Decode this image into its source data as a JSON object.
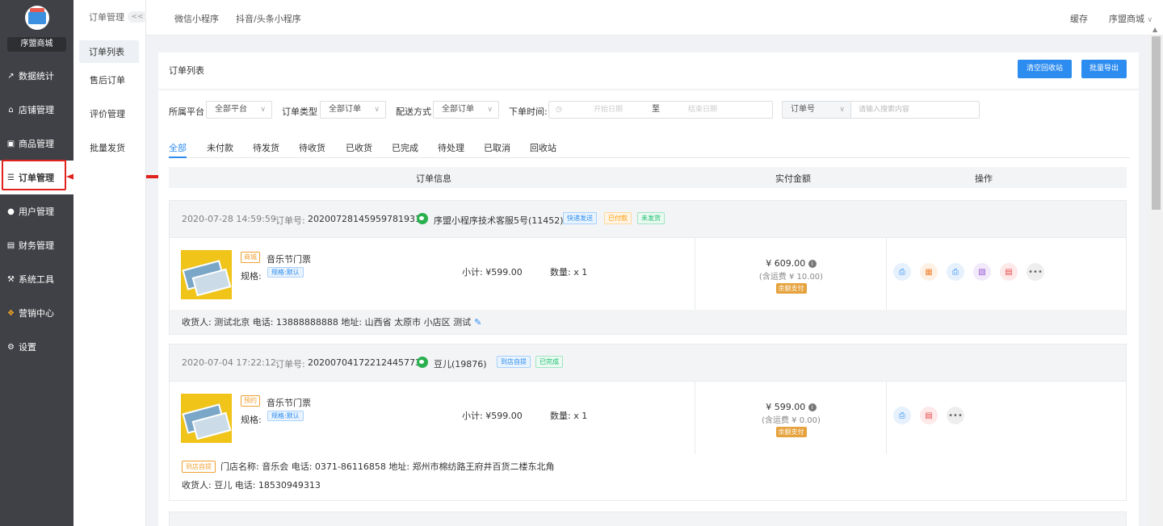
{
  "sidebar": {
    "shop_name": "序盟商城",
    "items": [
      {
        "label": "数据统计",
        "icon": "chart-icon"
      },
      {
        "label": "店铺管理",
        "icon": "shop-icon"
      },
      {
        "label": "商品管理",
        "icon": "goods-icon"
      },
      {
        "label": "订单管理",
        "icon": "order-icon"
      },
      {
        "label": "用户管理",
        "icon": "user-icon"
      },
      {
        "label": "财务管理",
        "icon": "finance-icon"
      },
      {
        "label": "系统工具",
        "icon": "wrench-icon"
      },
      {
        "label": "营销中心",
        "icon": "marketing-icon"
      },
      {
        "label": "设置",
        "icon": "gear-icon"
      }
    ]
  },
  "subnav": {
    "title": "订单管理",
    "collapse": "<<",
    "items": [
      "订单列表",
      "售后订单",
      "评价管理",
      "批量发货"
    ]
  },
  "topbar": {
    "links": [
      "微信小程序",
      "抖音/头条小程序"
    ],
    "cache": "缓存",
    "user": "序盟商城"
  },
  "page": {
    "title": "订单列表",
    "clear_btn": "清空回收站",
    "export_btn": "批量导出"
  },
  "filters": {
    "platform_label": "所属平台",
    "platform_value": "全部平台",
    "type_label": "订单类型",
    "type_value": "全部订单",
    "delivery_label": "配送方式",
    "delivery_value": "全部订单",
    "time_label": "下单时间:",
    "start_placeholder": "开始日期",
    "to": "至",
    "end_placeholder": "结束日期",
    "search_field": "订单号",
    "search_placeholder": "请输入搜索内容"
  },
  "tabs": [
    "全部",
    "未付款",
    "待发货",
    "待收货",
    "已收货",
    "已完成",
    "待处理",
    "已取消",
    "回收站"
  ],
  "table_head": {
    "info": "订单信息",
    "amount": "实付金额",
    "ops": "操作"
  },
  "orders": [
    {
      "time": "2020-07-28 14:59:59",
      "no_label": "订单号:",
      "no": "20200728145959781931",
      "customer": "序盟小程序技术客服5号(11452)",
      "tags": [
        "快递发送",
        "已付款",
        "未发货"
      ],
      "product_tag": "商城",
      "product": "音乐节门票",
      "spec_label": "规格:",
      "spec": "规格:默认",
      "subtotal": "小计: ¥599.00",
      "qty": "数量: x 1",
      "amount": "¥ 609.00",
      "shipping": "(含运费 ¥ 10.00)",
      "pay": "余额支付",
      "receiver": "收货人: 测试北京 电话: 13888888888 地址: 山西省 太原市 小店区 测试"
    },
    {
      "time": "2020-07-04 17:22:12",
      "no_label": "订单号:",
      "no": "20200704172212445773",
      "customer": "豆儿(19876)",
      "tags": [
        "到店自提",
        "已完成"
      ],
      "product_tag": "预约",
      "product": "音乐节门票",
      "spec_label": "规格:",
      "spec": "规格:默认",
      "subtotal": "小计: ¥599.00",
      "qty": "数量: x 1",
      "amount": "¥ 599.00",
      "shipping": "(含运费 ¥ 0.00)",
      "pay": "余额支付",
      "store_tag": "到店自提",
      "store": "门店名称: 音乐会 电话: 0371-86116858 地址: 郑州市棉纺路王府井百货二楼东北角",
      "receiver": "收货人: 豆儿 电话: 18530949313"
    }
  ],
  "colors": {
    "accent": "#2d8cf0",
    "sidebar": "#3f4146",
    "highlight": "#e0221d"
  }
}
